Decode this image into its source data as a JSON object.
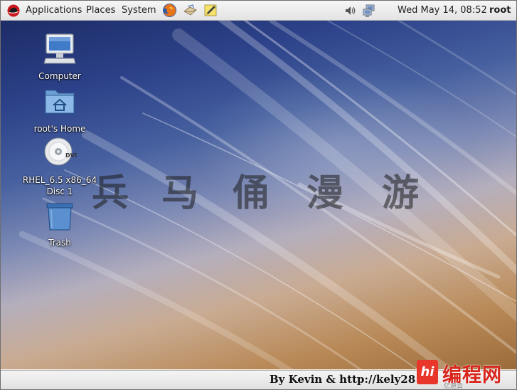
{
  "panel": {
    "menus": [
      "Applications",
      "Places",
      "System"
    ],
    "launchers": [
      "firefox-icon",
      "mail-icon",
      "notes-icon"
    ],
    "tray": [
      "volume-icon",
      "network-icon"
    ],
    "clock": "Wed May 14, 08:52",
    "user": "root"
  },
  "desktop": {
    "icons": [
      {
        "name": "computer",
        "label": "Computer",
        "icon": "computer-icon"
      },
      {
        "name": "home",
        "label": "root's Home",
        "icon": "home-folder-icon"
      },
      {
        "name": "dvd",
        "label": "RHEL_6.5 x86_64\nDisc 1",
        "icon": "dvd-icon"
      },
      {
        "name": "trash",
        "label": "Trash",
        "icon": "trash-icon"
      }
    ],
    "watermark": "兵马俑漫游"
  },
  "footer": {
    "credit": "By Kevin & http://kely28",
    "site_logo": "编程网",
    "logo_badge": "hi",
    "logo_sub": "亿速云"
  },
  "colors": {
    "panel_bg": "#e9e9e9",
    "desktop_top": "#1c2c66",
    "desktop_bottom": "#9b6b3a",
    "logo_red": "#e8362b"
  }
}
